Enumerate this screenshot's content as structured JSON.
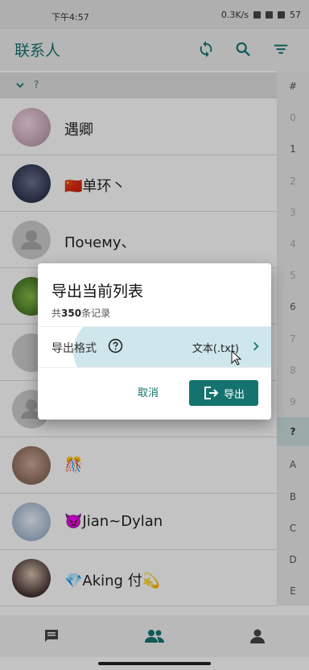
{
  "status_bar": {
    "time": "下午4:57",
    "speed": "0.3K/s",
    "battery": "57"
  },
  "app_bar": {
    "title": "联系人"
  },
  "group_header": {
    "label": "?"
  },
  "contacts": [
    {
      "name": "遇卿"
    },
    {
      "name": "🇨🇳单环丶"
    },
    {
      "name": "Почему、"
    },
    {
      "name": ""
    },
    {
      "name": ""
    },
    {
      "name": ""
    },
    {
      "name": "🎊"
    },
    {
      "name": "👿Jian~Dylan"
    },
    {
      "name": "💎Aking 付💫"
    }
  ],
  "index_bar": [
    {
      "label": "#",
      "state": "normal"
    },
    {
      "label": "0",
      "state": "dim"
    },
    {
      "label": "1",
      "state": "normal"
    },
    {
      "label": "2",
      "state": "dim"
    },
    {
      "label": "3",
      "state": "dim"
    },
    {
      "label": "4",
      "state": "dim"
    },
    {
      "label": "5",
      "state": "dim"
    },
    {
      "label": "6",
      "state": "normal"
    },
    {
      "label": "7",
      "state": "dim"
    },
    {
      "label": "8",
      "state": "dim"
    },
    {
      "label": "9",
      "state": "dim"
    },
    {
      "label": "?",
      "state": "active"
    },
    {
      "label": "A",
      "state": "normal"
    },
    {
      "label": "B",
      "state": "normal"
    },
    {
      "label": "C",
      "state": "normal"
    },
    {
      "label": "D",
      "state": "normal"
    },
    {
      "label": "E",
      "state": "normal"
    }
  ],
  "dialog": {
    "title": "导出当前列表",
    "count_prefix": "共",
    "count_value": "350",
    "count_suffix": "条记录",
    "format_label": "导出格式",
    "format_value": "文本(.txt)",
    "cancel_label": "取消",
    "export_label": "导出"
  },
  "colors": {
    "accent": "#14736f",
    "ripple": "#cfe6ec"
  }
}
